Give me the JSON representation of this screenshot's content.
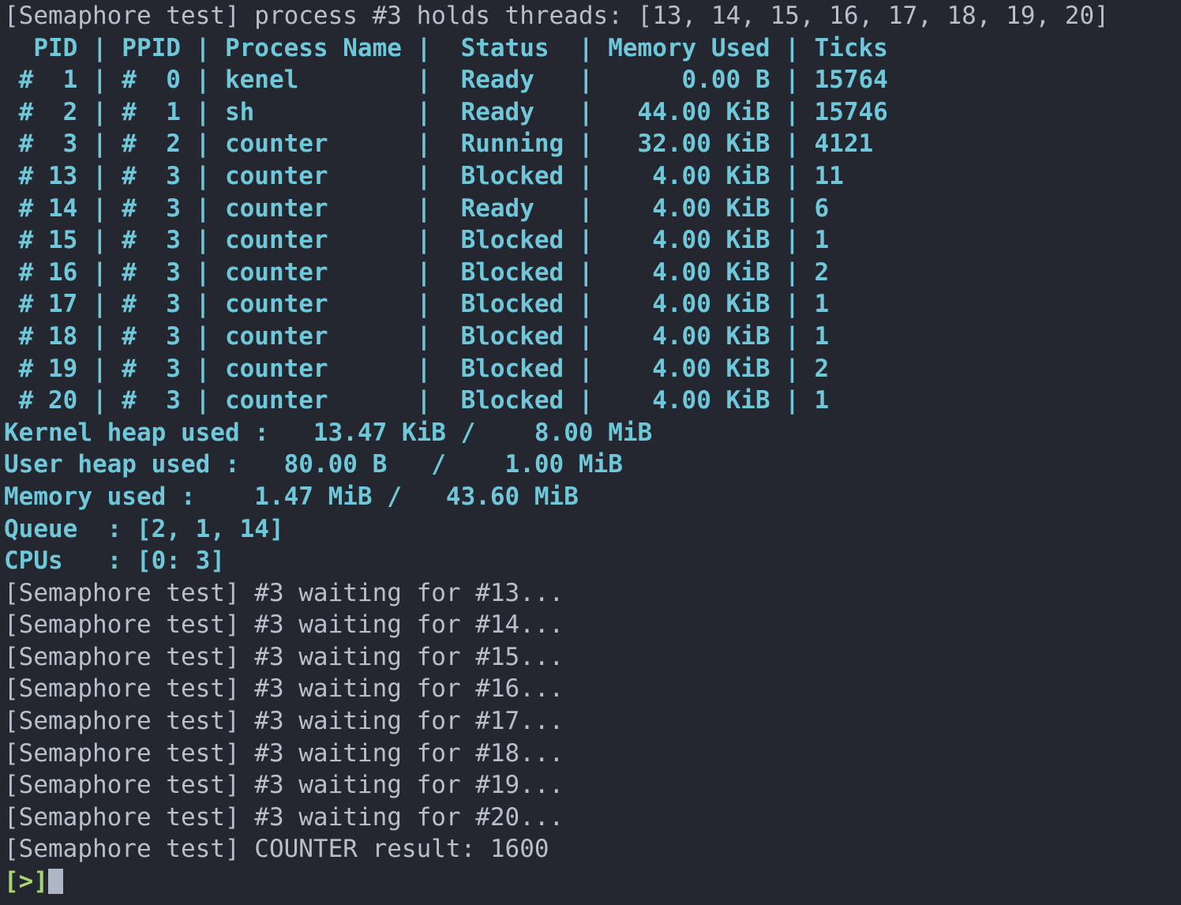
{
  "terminal": {
    "background_color": "#24272F",
    "gray_color": "#B8BFCC",
    "cyan_color": "#6FC8DA",
    "green_color": "#A5D672",
    "cursor_color": "#AEB7C6"
  },
  "header_log": {
    "text": "[Semaphore test] process #3 holds threads: [13, 14, 15, 16, 17, 18, 19, 20]"
  },
  "process_table": {
    "columns": [
      "PID",
      "PPID",
      "Process Name",
      "Status",
      "Memory Used",
      "Ticks"
    ],
    "header_line": "  PID | PPID | Process Name |  Status  | Memory Used | Ticks",
    "rows": [
      {
        "pid": "#  1",
        "ppid": "#  0",
        "name": "kenel",
        "status": "Ready",
        "memory": "0.00 B",
        "ticks": "15764",
        "line": " #  1 | #  0 | kenel        |  Ready   |      0.00 B | 15764"
      },
      {
        "pid": "#  2",
        "ppid": "#  1",
        "name": "sh",
        "status": "Ready",
        "memory": "44.00 KiB",
        "ticks": "15746",
        "line": " #  2 | #  1 | sh           |  Ready   |   44.00 KiB | 15746"
      },
      {
        "pid": "#  3",
        "ppid": "#  2",
        "name": "counter",
        "status": "Running",
        "memory": "32.00 KiB",
        "ticks": "4121",
        "line": " #  3 | #  2 | counter      |  Running |   32.00 KiB | 4121"
      },
      {
        "pid": "# 13",
        "ppid": "#  3",
        "name": "counter",
        "status": "Blocked",
        "memory": "4.00 KiB",
        "ticks": "11",
        "line": " # 13 | #  3 | counter      |  Blocked |    4.00 KiB | 11"
      },
      {
        "pid": "# 14",
        "ppid": "#  3",
        "name": "counter",
        "status": "Ready",
        "memory": "4.00 KiB",
        "ticks": "6",
        "line": " # 14 | #  3 | counter      |  Ready   |    4.00 KiB | 6"
      },
      {
        "pid": "# 15",
        "ppid": "#  3",
        "name": "counter",
        "status": "Blocked",
        "memory": "4.00 KiB",
        "ticks": "1",
        "line": " # 15 | #  3 | counter      |  Blocked |    4.00 KiB | 1"
      },
      {
        "pid": "# 16",
        "ppid": "#  3",
        "name": "counter",
        "status": "Blocked",
        "memory": "4.00 KiB",
        "ticks": "2",
        "line": " # 16 | #  3 | counter      |  Blocked |    4.00 KiB | 2"
      },
      {
        "pid": "# 17",
        "ppid": "#  3",
        "name": "counter",
        "status": "Blocked",
        "memory": "4.00 KiB",
        "ticks": "1",
        "line": " # 17 | #  3 | counter      |  Blocked |    4.00 KiB | 1"
      },
      {
        "pid": "# 18",
        "ppid": "#  3",
        "name": "counter",
        "status": "Blocked",
        "memory": "4.00 KiB",
        "ticks": "1",
        "line": " # 18 | #  3 | counter      |  Blocked |    4.00 KiB | 1"
      },
      {
        "pid": "# 19",
        "ppid": "#  3",
        "name": "counter",
        "status": "Blocked",
        "memory": "4.00 KiB",
        "ticks": "2",
        "line": " # 19 | #  3 | counter      |  Blocked |    4.00 KiB | 2"
      },
      {
        "pid": "# 20",
        "ppid": "#  3",
        "name": "counter",
        "status": "Blocked",
        "memory": "4.00 KiB",
        "ticks": "1",
        "line": " # 20 | #  3 | counter      |  Blocked |    4.00 KiB | 1"
      }
    ]
  },
  "summary": {
    "kernel_heap": {
      "label": "Kernel heap used :",
      "used": "13.47 KiB",
      "total": "8.00 MiB",
      "line": "Kernel heap used :   13.47 KiB /    8.00 MiB"
    },
    "user_heap": {
      "label": "User heap used :",
      "used": "80.00 B",
      "total": "1.00 MiB",
      "line": "User heap used :   80.00 B   /    1.00 MiB"
    },
    "memory_used": {
      "label": "Memory used :",
      "used": "1.47 MiB",
      "total": "43.60 MiB",
      "line": "Memory used :    1.47 MiB /   43.60 MiB"
    },
    "queue": {
      "label": "Queue",
      "value": "[2, 1, 14]",
      "line": "Queue  : [2, 1, 14]"
    },
    "cpus": {
      "label": "CPUs",
      "value": "[0: 3]",
      "line": "CPUs   : [0: 3]"
    }
  },
  "semaphore_log": {
    "lines": [
      "[Semaphore test] #3 waiting for #13...",
      "[Semaphore test] #3 waiting for #14...",
      "[Semaphore test] #3 waiting for #15...",
      "[Semaphore test] #3 waiting for #16...",
      "[Semaphore test] #3 waiting for #17...",
      "[Semaphore test] #3 waiting for #18...",
      "[Semaphore test] #3 waiting for #19...",
      "[Semaphore test] #3 waiting for #20...",
      "[Semaphore test] COUNTER result: 1600"
    ]
  },
  "prompt": {
    "symbol": "[>]",
    "input_value": ""
  }
}
